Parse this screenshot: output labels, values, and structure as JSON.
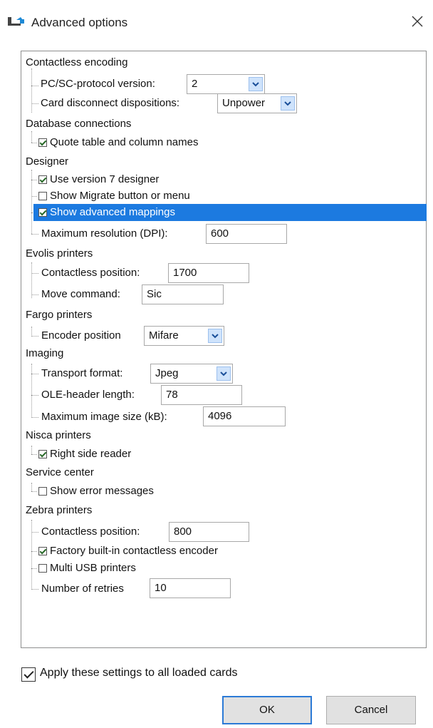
{
  "window": {
    "title": "Advanced options",
    "close_symbol": "✕"
  },
  "tree": {
    "contactless_encoding": {
      "label": "Contactless encoding",
      "pcsc_label": "PC/SC-protocol version:",
      "pcsc_value": "2",
      "disconnect_label": "Card disconnect dispositions:",
      "disconnect_value": "Unpower"
    },
    "database": {
      "label": "Database connections",
      "quote_label": "Quote table and column names",
      "quote_checked": true
    },
    "designer": {
      "label": "Designer",
      "v7_label": "Use version 7 designer",
      "v7_checked": true,
      "migrate_label": "Show Migrate button or menu",
      "migrate_checked": false,
      "adv_label": "Show advanced mappings",
      "adv_checked": true,
      "res_label": "Maximum resolution (DPI):",
      "res_value": "600"
    },
    "evolis": {
      "label": "Evolis printers",
      "pos_label": "Contactless position:",
      "pos_value": "1700",
      "move_label": "Move command:",
      "move_value": "Sic"
    },
    "fargo": {
      "label": "Fargo printers",
      "enc_label": "Encoder position",
      "enc_value": "Mifare"
    },
    "imaging": {
      "label": "Imaging",
      "fmt_label": "Transport format:",
      "fmt_value": "Jpeg",
      "ole_label": "OLE-header length:",
      "ole_value": "78",
      "max_label": "Maximum image size (kB):",
      "max_value": "4096"
    },
    "nisca": {
      "label": "Nisca printers",
      "right_label": "Right side reader",
      "right_checked": true
    },
    "service": {
      "label": "Service center",
      "err_label": "Show error messages",
      "err_checked": false
    },
    "zebra": {
      "label": "Zebra printers",
      "pos_label": "Contactless position:",
      "pos_value": "800",
      "factory_label": "Factory built-in contactless encoder",
      "factory_checked": true,
      "multi_label": "Multi USB printers",
      "multi_checked": false,
      "retries_label": "Number of retries",
      "retries_value": "10"
    }
  },
  "footer": {
    "apply_label": "Apply these settings to all loaded cards",
    "apply_checked": true,
    "ok_label": "OK",
    "cancel_label": "Cancel"
  },
  "colors": {
    "selection": "#1c7ae0",
    "combo_arrow": "#cfe3fb",
    "ok_border": "#2c7ad6"
  }
}
